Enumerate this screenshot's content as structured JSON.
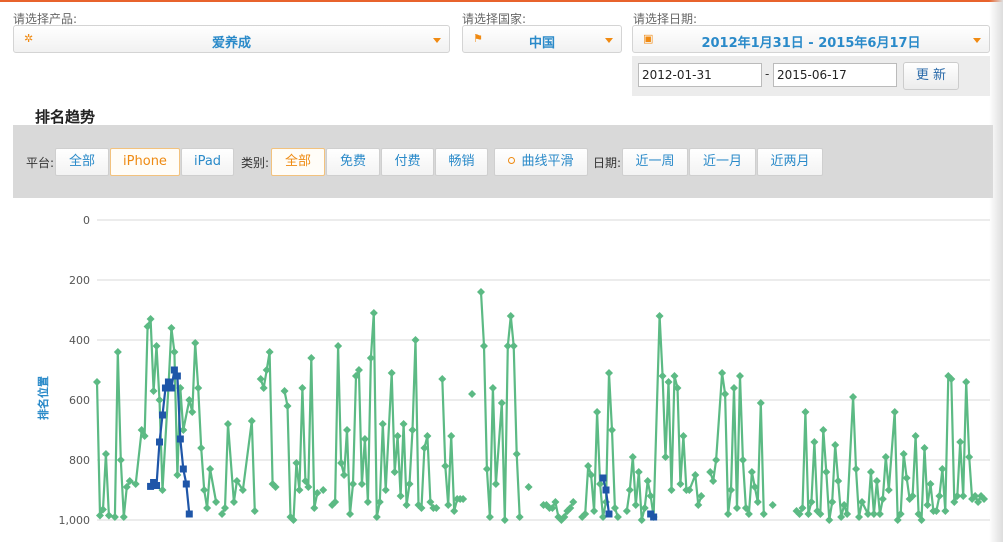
{
  "filters": {
    "product_label": "请选择产品:",
    "product_value": "爱养成",
    "country_label": "请选择国家:",
    "country_value": "中国",
    "date_label": "请选择日期:",
    "date_range": "2012年1月31日 - 2015年6月17日",
    "start_date": "2012-01-31",
    "end_date": "2015-06-17",
    "update_button": "更 新"
  },
  "section_title": "排名趋势",
  "toolbar": {
    "platform_label": "平台:",
    "platforms": [
      "全部",
      "iPhone",
      "iPad"
    ],
    "platform_selected": "iPhone",
    "category_label": "类别:",
    "categories": [
      "全部",
      "免费",
      "付费",
      "畅销"
    ],
    "category_selected": "全部",
    "smooth_label": "曲线平滑",
    "date_label": "日期:",
    "ranges": [
      "近一周",
      "近一月",
      "近两月"
    ]
  },
  "colors": {
    "accent": "#ee8a12",
    "link": "#2a8ac9",
    "green_series": "#5cba84",
    "blue_series": "#1f56a8"
  },
  "chart_data": {
    "type": "line",
    "ylabel": "排名位置",
    "ylim": [
      0,
      1000
    ],
    "y_reversed": true,
    "yticks": [
      "0",
      "200",
      "400",
      "600",
      "800",
      "1,000"
    ],
    "xlim": [
      0,
      300
    ],
    "series": [
      {
        "color": "#5cba84",
        "marker": "diamond",
        "segments": [
          [
            [
              0,
              540
            ],
            [
              1,
              985
            ],
            [
              2,
              965
            ],
            [
              3,
              780
            ],
            [
              4,
              985
            ],
            [
              6,
              990
            ],
            [
              7,
              440
            ],
            [
              8,
              800
            ],
            [
              9,
              990
            ],
            [
              10,
              890
            ],
            [
              11,
              870
            ],
            [
              13,
              880
            ],
            [
              15,
              700
            ],
            [
              16,
              720
            ],
            [
              17,
              355
            ],
            [
              18,
              330
            ],
            [
              19,
              570
            ],
            [
              20,
              420
            ],
            [
              21,
              600
            ],
            [
              22,
              900
            ],
            [
              24,
              560
            ],
            [
              25,
              360
            ],
            [
              26,
              440
            ],
            [
              27,
              850
            ],
            [
              28,
              560
            ],
            [
              29,
              700
            ],
            [
              31,
              600
            ],
            [
              32,
              640
            ],
            [
              33,
              410
            ],
            [
              34,
              560
            ],
            [
              35,
              760
            ],
            [
              36,
              900
            ],
            [
              37,
              960
            ],
            [
              38,
              830
            ],
            [
              40,
              940
            ]
          ],
          [
            [
              42,
              980
            ],
            [
              43,
              960
            ],
            [
              44,
              680
            ],
            [
              46,
              940
            ],
            [
              47,
              870
            ],
            [
              49,
              900
            ],
            [
              52,
              670
            ],
            [
              53,
              970
            ]
          ],
          [
            [
              55,
              530
            ],
            [
              56,
              560
            ],
            [
              57,
              500
            ],
            [
              58,
              440
            ],
            [
              59,
              880
            ],
            [
              60,
              890
            ]
          ],
          [
            [
              63,
              570
            ],
            [
              64,
              620
            ],
            [
              65,
              990
            ],
            [
              66,
              1000
            ],
            [
              67,
              810
            ],
            [
              68,
              900
            ],
            [
              69,
              560
            ],
            [
              70,
              870
            ],
            [
              71,
              890
            ],
            [
              72,
              460
            ],
            [
              73,
              960
            ],
            [
              74,
              910
            ]
          ],
          [
            [
              76,
              900
            ]
          ],
          [
            [
              79,
              950
            ],
            [
              80,
              940
            ],
            [
              81,
              420
            ],
            [
              82,
              810
            ],
            [
              83,
              850
            ],
            [
              84,
              700
            ],
            [
              85,
              980
            ],
            [
              86,
              880
            ],
            [
              87,
              520
            ],
            [
              88,
              500
            ],
            [
              89,
              880
            ],
            [
              90,
              730
            ],
            [
              91,
              940
            ],
            [
              92,
              460
            ],
            [
              93,
              310
            ],
            [
              94,
              990
            ],
            [
              95,
              940
            ],
            [
              96,
              680
            ],
            [
              97,
              900
            ],
            [
              99,
              510
            ],
            [
              100,
              840
            ],
            [
              101,
              720
            ],
            [
              102,
              920
            ],
            [
              103,
              680
            ],
            [
              104,
              950
            ],
            [
              105,
              880
            ],
            [
              106,
              700
            ],
            [
              107,
              400
            ],
            [
              108,
              950
            ],
            [
              109,
              960
            ],
            [
              110,
              760
            ],
            [
              111,
              720
            ],
            [
              112,
              940
            ],
            [
              113,
              960
            ],
            [
              114,
              960
            ]
          ],
          [
            [
              116,
              530
            ],
            [
              117,
              820
            ],
            [
              118,
              950
            ],
            [
              119,
              720
            ],
            [
              120,
              970
            ],
            [
              121,
              930
            ],
            [
              122,
              930
            ],
            [
              123,
              930
            ]
          ],
          [
            [
              126,
              580
            ]
          ],
          [
            [
              129,
              240
            ],
            [
              130,
              420
            ],
            [
              131,
              830
            ],
            [
              132,
              990
            ],
            [
              133,
              560
            ],
            [
              134,
              880
            ],
            [
              136,
              610
            ],
            [
              137,
              1000
            ],
            [
              138,
              420
            ],
            [
              139,
              320
            ],
            [
              140,
              420
            ],
            [
              141,
              780
            ],
            [
              142,
              990
            ]
          ],
          [
            [
              145,
              890
            ]
          ],
          [
            [
              150,
              950
            ],
            [
              151,
              950
            ],
            [
              152,
              960
            ],
            [
              153,
              960
            ],
            [
              154,
              940
            ],
            [
              155,
              990
            ],
            [
              156,
              1000
            ],
            [
              157,
              990
            ],
            [
              158,
              970
            ],
            [
              159,
              960
            ],
            [
              160,
              940
            ]
          ],
          [
            [
              163,
              990
            ],
            [
              164,
              980
            ],
            [
              165,
              820
            ],
            [
              166,
              850
            ],
            [
              167,
              970
            ],
            [
              168,
              640
            ],
            [
              169,
              880
            ],
            [
              170,
              990
            ],
            [
              171,
              940
            ],
            [
              172,
              510
            ],
            [
              173,
              700
            ],
            [
              174,
              960
            ],
            [
              175,
              990
            ]
          ],
          [
            [
              178,
              970
            ],
            [
              179,
              900
            ],
            [
              180,
              790
            ],
            [
              181,
              950
            ],
            [
              182,
              840
            ],
            [
              183,
              1000
            ],
            [
              184,
              960
            ],
            [
              185,
              870
            ],
            [
              186,
              920
            ],
            [
              187,
              990
            ],
            [
              189,
              320
            ],
            [
              190,
              520
            ],
            [
              191,
              790
            ],
            [
              192,
              540
            ],
            [
              193,
              900
            ],
            [
              194,
              520
            ],
            [
              195,
              560
            ],
            [
              196,
              880
            ],
            [
              197,
              720
            ],
            [
              198,
              900
            ],
            [
              199,
              900
            ],
            [
              201,
              850
            ],
            [
              202,
              950
            ],
            [
              203,
              920
            ]
          ],
          [
            [
              206,
              840
            ],
            [
              207,
              870
            ],
            [
              208,
              800
            ],
            [
              210,
              510
            ],
            [
              211,
              580
            ],
            [
              212,
              980
            ],
            [
              213,
              900
            ],
            [
              214,
              560
            ],
            [
              215,
              960
            ],
            [
              216,
              520
            ],
            [
              217,
              800
            ],
            [
              218,
              960
            ],
            [
              219,
              980
            ],
            [
              220,
              840
            ],
            [
              221,
              890
            ],
            [
              222,
              940
            ],
            [
              223,
              610
            ],
            [
              224,
              980
            ]
          ],
          [
            [
              227,
              950
            ]
          ],
          [
            [
              235,
              970
            ],
            [
              236,
              980
            ],
            [
              237,
              960
            ],
            [
              238,
              640
            ],
            [
              239,
              980
            ],
            [
              240,
              940
            ],
            [
              241,
              740
            ],
            [
              242,
              970
            ],
            [
              243,
              980
            ],
            [
              244,
              700
            ],
            [
              245,
              840
            ],
            [
              246,
              1000
            ],
            [
              247,
              940
            ],
            [
              248,
              750
            ],
            [
              249,
              870
            ],
            [
              250,
              990
            ],
            [
              251,
              950
            ],
            [
              252,
              980
            ],
            [
              254,
              590
            ],
            [
              255,
              830
            ],
            [
              256,
              990
            ],
            [
              257,
              940
            ],
            [
              259,
              980
            ],
            [
              260,
              840
            ],
            [
              261,
              980
            ],
            [
              262,
              870
            ],
            [
              263,
              980
            ],
            [
              264,
              930
            ],
            [
              265,
              790
            ],
            [
              266,
              900
            ],
            [
              268,
              640
            ],
            [
              269,
              1000
            ],
            [
              270,
              980
            ],
            [
              271,
              780
            ],
            [
              272,
              860
            ],
            [
              273,
              930
            ],
            [
              274,
              920
            ],
            [
              275,
              720
            ],
            [
              276,
              980
            ],
            [
              277,
              1000
            ],
            [
              278,
              760
            ],
            [
              279,
              950
            ],
            [
              280,
              880
            ],
            [
              281,
              970
            ],
            [
              282,
              970
            ],
            [
              283,
              920
            ],
            [
              284,
              830
            ],
            [
              285,
              970
            ],
            [
              286,
              520
            ],
            [
              287,
              530
            ],
            [
              288,
              940
            ],
            [
              289,
              920
            ],
            [
              290,
              740
            ],
            [
              291,
              920
            ],
            [
              292,
              540
            ],
            [
              293,
              790
            ],
            [
              294,
              930
            ],
            [
              295,
              920
            ],
            [
              296,
              940
            ],
            [
              297,
              920
            ],
            [
              298,
              930
            ]
          ],
          [
            [
              308,
              1000
            ],
            [
              309,
              990
            ],
            [
              310,
              990
            ],
            [
              311,
              960
            ]
          ],
          [
            [
              314,
              405
            ],
            [
              315,
              540
            ],
            [
              316,
              670
            ],
            [
              317,
              720
            ]
          ]
        ]
      },
      {
        "color": "#1f56a8",
        "marker": "square",
        "segments": [
          [
            [
              18,
              888
            ],
            [
              19,
              875
            ],
            [
              20,
              885
            ],
            [
              21,
              740
            ],
            [
              22,
              650
            ],
            [
              23,
              560
            ],
            [
              24,
              540
            ],
            [
              25,
              560
            ],
            [
              26,
              500
            ],
            [
              27,
              520
            ],
            [
              28,
              730
            ],
            [
              29,
              830
            ],
            [
              30,
              880
            ],
            [
              31,
              980
            ]
          ],
          [
            [
              170,
              860
            ],
            [
              171,
              900
            ],
            [
              172,
              980
            ]
          ],
          [
            [
              186,
              980
            ],
            [
              187,
              990
            ]
          ]
        ]
      }
    ]
  }
}
